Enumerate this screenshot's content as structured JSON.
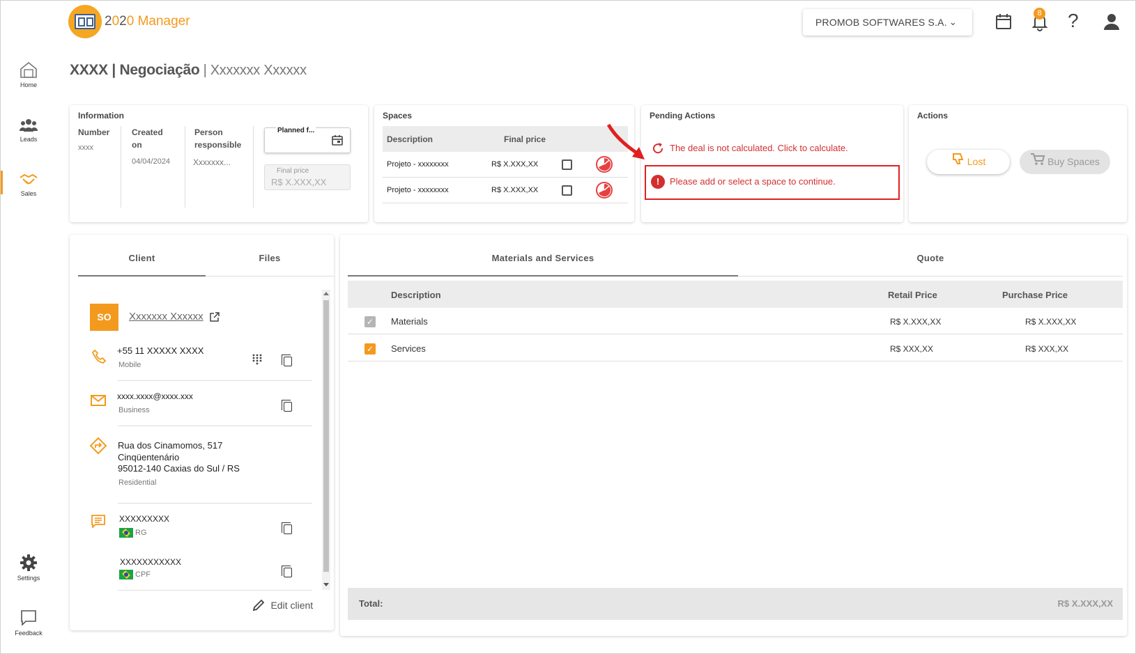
{
  "app": {
    "logo_prefix": "2",
    "logo_zero": "0",
    "logo_rest": "2",
    "logo_zero2": "0",
    "logo_name": " Manager",
    "company": "PROMOB SOFTWARES S.A.",
    "notifications_count": "8",
    "brand_color": "#f39a1e",
    "error_color": "#d32f2f"
  },
  "sidebar": {
    "items": [
      {
        "label": "Home",
        "icon": "home-icon"
      },
      {
        "label": "Leads",
        "icon": "people-icon"
      },
      {
        "label": "Sales",
        "icon": "handshake-icon"
      },
      {
        "label": "Settings",
        "icon": "gear-icon"
      },
      {
        "label": "Feedback",
        "icon": "chat-bubble-icon"
      }
    ]
  },
  "page": {
    "title": "XXXX | Negociação",
    "subtitle": " | Xxxxxxx Xxxxxx"
  },
  "information": {
    "title": "Information",
    "number_label": "Number",
    "number_value": "xxxx",
    "created_label1": "Created",
    "created_label2": "on",
    "created_value": "04/04/2024",
    "person_label1": "Person",
    "person_label2": "responsible",
    "person_value": "Xxxxxxx...",
    "planned_label": "Planned f...",
    "final_price_label": "Final price",
    "final_price_value": "R$ X.XXX,XX"
  },
  "spaces": {
    "title": "Spaces",
    "col_description": "Description",
    "col_final_price": "Final price",
    "rows": [
      {
        "description": "Projeto - xxxxxxxx",
        "price": "R$ X.XXX,XX"
      },
      {
        "description": "Projeto - xxxxxxxx",
        "price": "R$ X.XXX,XX"
      }
    ]
  },
  "pending": {
    "title": "Pending Actions",
    "calc_msg": "The deal is not calculated. Click to calculate.",
    "space_msg": "Please add or select a space to continue."
  },
  "actions": {
    "title": "Actions",
    "lost_label": "Lost",
    "buy_label": "Buy Spaces"
  },
  "left_tabs": {
    "client": "Client",
    "files": "Files"
  },
  "client": {
    "initials": "SO",
    "name": "Xxxxxxx Xxxxxx",
    "phone": "+55 11 XXXXX XXXX",
    "phone_type": "Mobile",
    "email": "xxxx.xxxx@xxxx.xxx",
    "email_type": "Business",
    "address_line1": "Rua dos Cinamomos, 517",
    "address_line2": "Cinqüentenário",
    "address_line3": "95012-140 Caxias do Sul / RS",
    "address_type": "Residential",
    "doc1_value": "XXXXXXXXX",
    "doc1_type": "RG",
    "doc2_value": "XXXXXXXXXXX",
    "doc2_type": "CPF",
    "edit_label": "Edit client"
  },
  "right_tabs": {
    "materials": "Materials and Services",
    "quote": "Quote"
  },
  "materials": {
    "col_description": "Description",
    "col_retail": "Retail Price",
    "col_purchase": "Purchase Price",
    "rows": [
      {
        "description": "Materials",
        "retail": "R$ X.XXX,XX",
        "purchase": "R$ X.XXX,XX",
        "checked": true,
        "disabled": true
      },
      {
        "description": "Services",
        "retail": "R$ XXX,XX",
        "purchase": "R$ XXX,XX",
        "checked": true,
        "disabled": false
      }
    ],
    "total_label": "Total:",
    "total_value": "R$ X.XXX,XX"
  }
}
